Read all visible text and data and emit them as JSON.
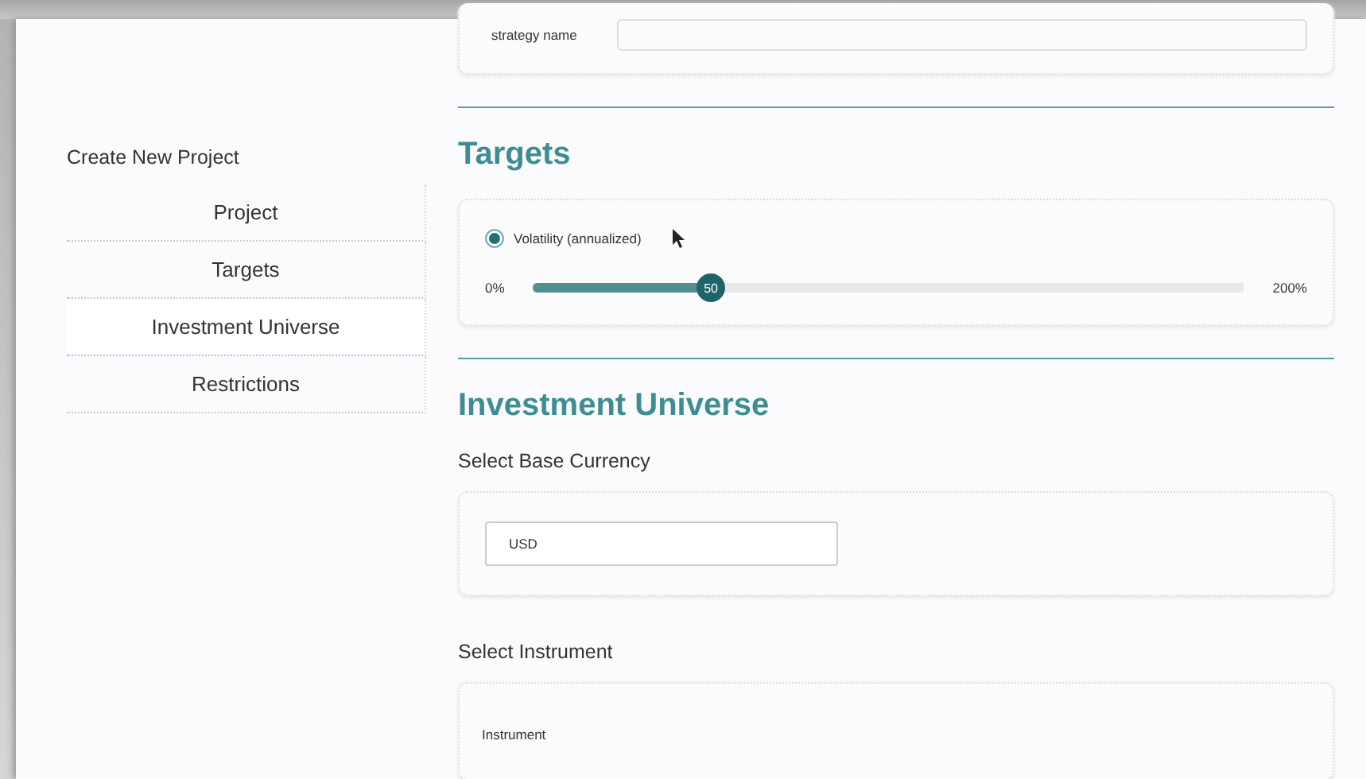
{
  "sidebar": {
    "title": "Create New Project",
    "items": [
      {
        "label": "Project",
        "selected": false
      },
      {
        "label": "Targets",
        "selected": false
      },
      {
        "label": "Investment Universe",
        "selected": true
      },
      {
        "label": "Restrictions",
        "selected": false
      }
    ]
  },
  "strategy": {
    "label": "strategy name"
  },
  "targets": {
    "heading": "Targets",
    "radio": {
      "label": "Volatility (annualized)",
      "checked": true
    },
    "slider": {
      "min_label": "0%",
      "max_label": "200%",
      "thumb_label": "50",
      "level": 0.25
    }
  },
  "universe": {
    "heading": "Investment Universe",
    "currency": {
      "label": "Select Base Currency",
      "value": "USD"
    },
    "instrument": {
      "label": "Select Instrument",
      "field_label": "Instrument"
    }
  }
}
